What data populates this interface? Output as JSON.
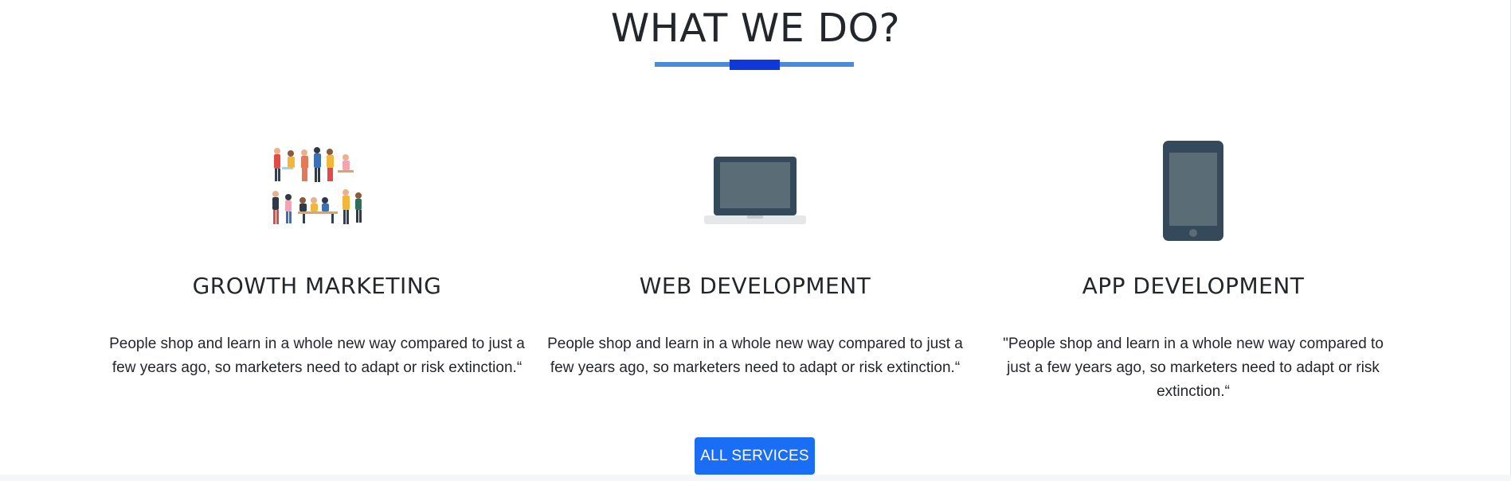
{
  "section": {
    "title": "WHAT WE DO?"
  },
  "services": [
    {
      "title": "GROWTH MARKETING",
      "description": "People shop and learn in a whole new way compared to just a few years ago, so marketers need to adapt or risk extinction.“",
      "icon": "team-illustration-icon"
    },
    {
      "title": "WEB DEVELOPMENT",
      "description": "People shop and learn in a whole new way compared to just a few years ago, so marketers need to adapt or risk extinction.“",
      "icon": "laptop-icon"
    },
    {
      "title": "APP DEVELOPMENT",
      "description": "\"People shop and learn in a whole new way compared to just a few years ago, so marketers need to adapt or risk extinction.“",
      "icon": "smartphone-icon"
    }
  ],
  "cta": {
    "label": "ALL SERVICES"
  },
  "colors": {
    "accent_line": "#4a8ad8",
    "accent_center": "#1038d9",
    "button": "#1a6ef5",
    "device_dark": "#34495a",
    "device_screen": "#5a6c76"
  }
}
